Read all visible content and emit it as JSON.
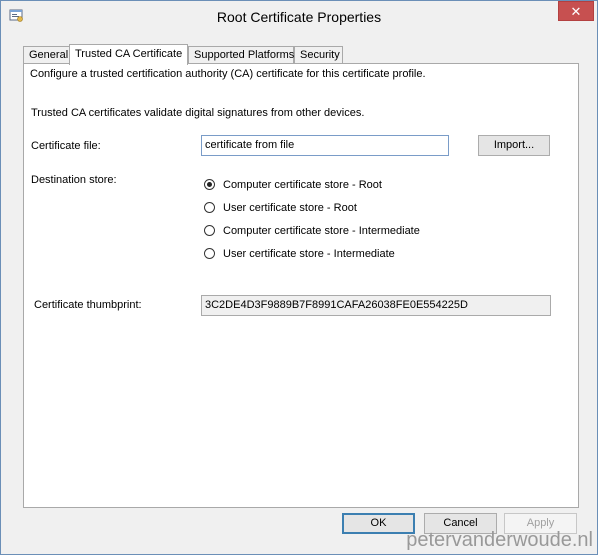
{
  "window": {
    "title": "Root Certificate Properties",
    "close_label": "✕"
  },
  "tabs": [
    {
      "label": "General",
      "active": false
    },
    {
      "label": "Trusted CA Certificate",
      "active": true
    },
    {
      "label": "Supported Platforms",
      "active": false
    },
    {
      "label": "Security",
      "active": false
    }
  ],
  "panel": {
    "description": "Configure a trusted certification authority (CA) certificate for this certificate profile.",
    "info": "Trusted CA certificates validate digital signatures from other devices.",
    "certificate_file_label": "Certificate file:",
    "certificate_file_value": "certificate from file",
    "import_label": "Import...",
    "destination_store_label": "Destination store:",
    "stores": [
      {
        "label": "Computer certificate store - Root",
        "selected": true
      },
      {
        "label": "User certificate store - Root",
        "selected": false
      },
      {
        "label": "Computer certificate store - Intermediate",
        "selected": false
      },
      {
        "label": "User certificate store - Intermediate",
        "selected": false
      }
    ],
    "thumbprint_label": "Certificate thumbprint:",
    "thumbprint_value": "3C2DE4D3F9889B7F8991CAFA26038FE0E554225D"
  },
  "footer": {
    "ok_label": "OK",
    "cancel_label": "Cancel",
    "apply_label": "Apply"
  },
  "watermark": "petervanderwoude.nl"
}
